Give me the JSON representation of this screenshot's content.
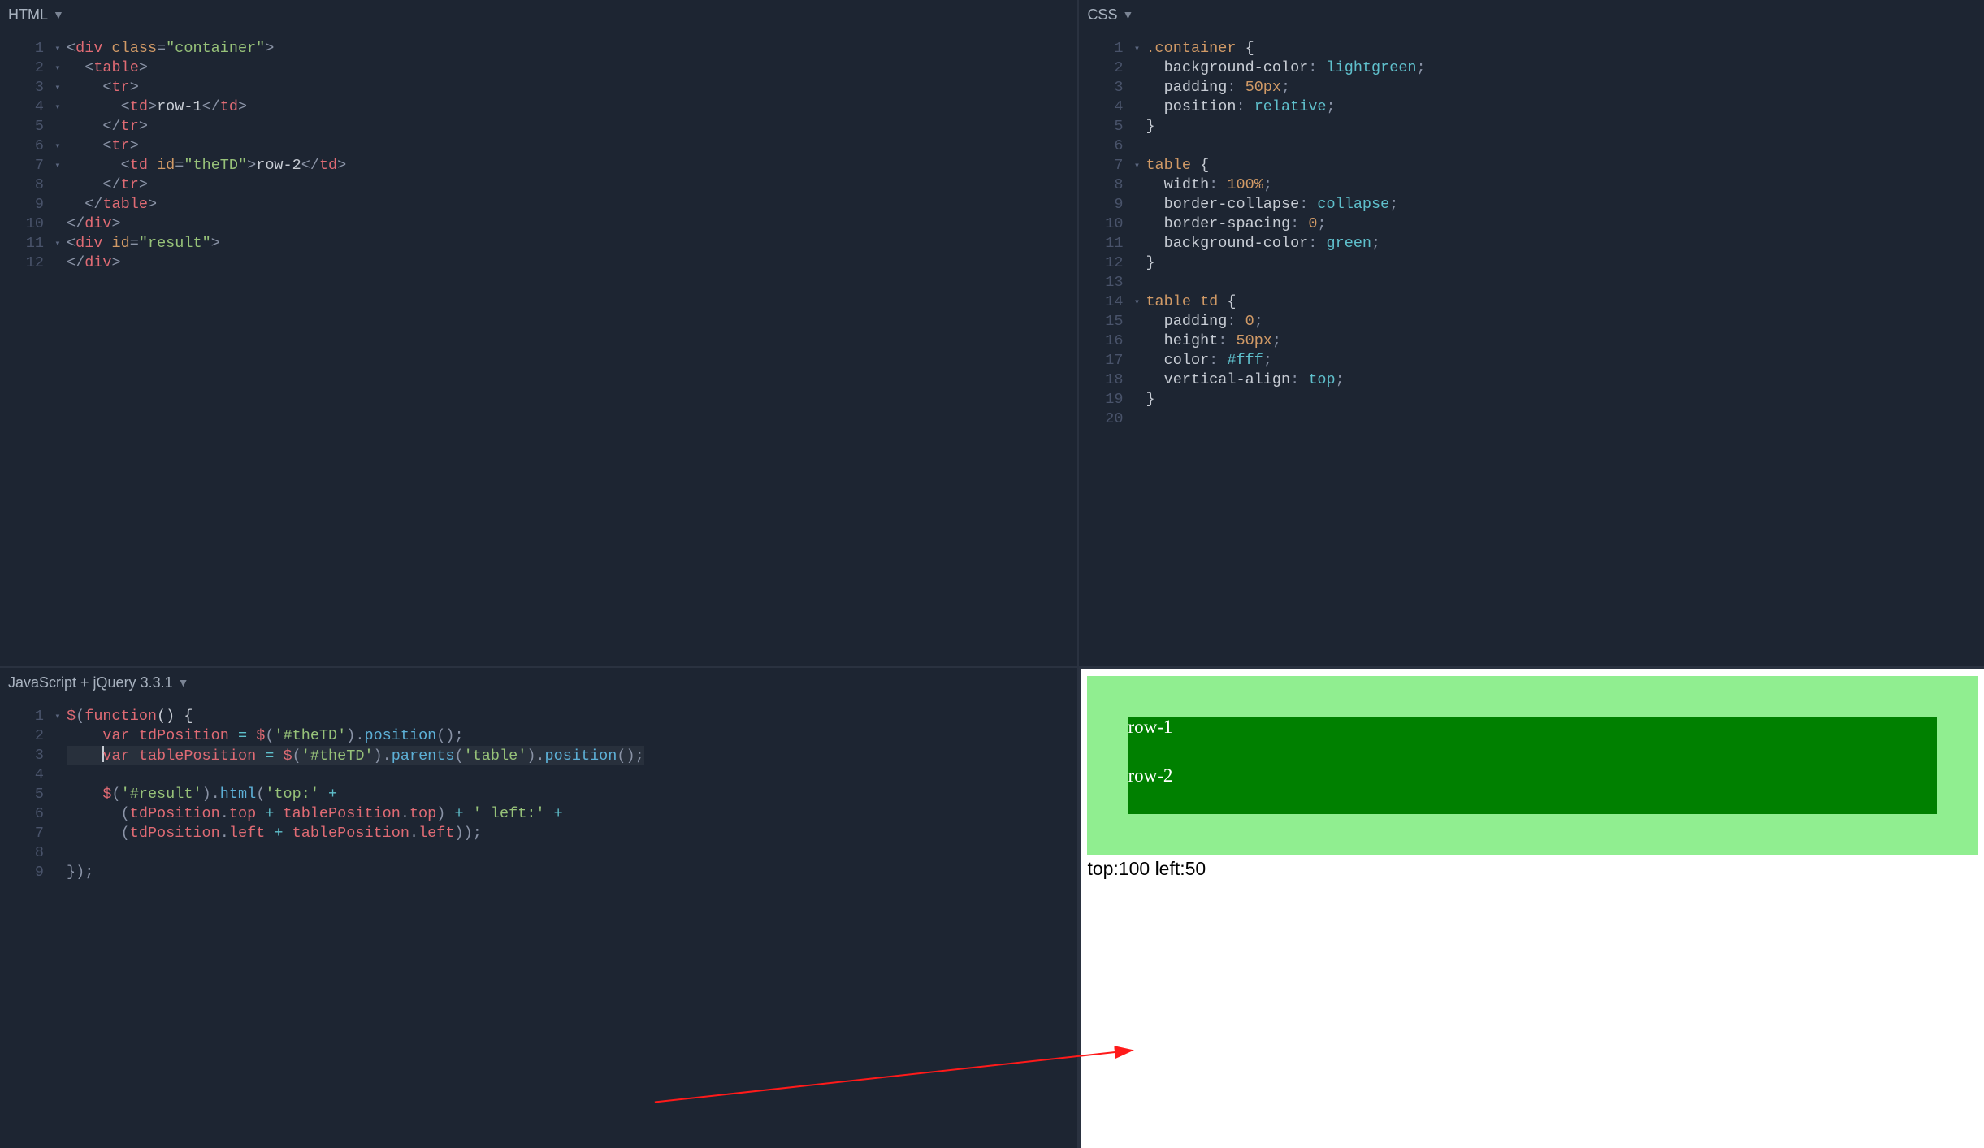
{
  "panes": {
    "html": {
      "title": "HTML",
      "lines": {
        "count": 12,
        "fold": [
          "▾",
          "▾",
          "▾",
          "▾",
          "",
          "▾",
          "▾",
          "",
          "",
          "",
          "▾",
          ""
        ],
        "tokens": [
          [
            [
              "<",
              "c-punct"
            ],
            [
              "div",
              "c-tag"
            ],
            [
              " ",
              "c-text"
            ],
            [
              "class",
              "c-attr"
            ],
            [
              "=",
              "c-punct"
            ],
            [
              "\"container\"",
              "c-string"
            ],
            [
              ">",
              "c-punct"
            ]
          ],
          [
            [
              "  ",
              "c-text"
            ],
            [
              "<",
              "c-punct"
            ],
            [
              "table",
              "c-tag"
            ],
            [
              ">",
              "c-punct"
            ]
          ],
          [
            [
              "    ",
              "c-text"
            ],
            [
              "<",
              "c-punct"
            ],
            [
              "tr",
              "c-tag"
            ],
            [
              ">",
              "c-punct"
            ]
          ],
          [
            [
              "      ",
              "c-text"
            ],
            [
              "<",
              "c-punct"
            ],
            [
              "td",
              "c-tag"
            ],
            [
              ">",
              "c-punct"
            ],
            [
              "row-1",
              "c-text"
            ],
            [
              "</",
              "c-punct"
            ],
            [
              "td",
              "c-tag"
            ],
            [
              ">",
              "c-punct"
            ]
          ],
          [
            [
              "    ",
              "c-text"
            ],
            [
              "</",
              "c-punct"
            ],
            [
              "tr",
              "c-tag"
            ],
            [
              ">",
              "c-punct"
            ]
          ],
          [
            [
              "    ",
              "c-text"
            ],
            [
              "<",
              "c-punct"
            ],
            [
              "tr",
              "c-tag"
            ],
            [
              ">",
              "c-punct"
            ]
          ],
          [
            [
              "      ",
              "c-text"
            ],
            [
              "<",
              "c-punct"
            ],
            [
              "td",
              "c-tag"
            ],
            [
              " ",
              "c-text"
            ],
            [
              "id",
              "c-attr"
            ],
            [
              "=",
              "c-punct"
            ],
            [
              "\"theTD\"",
              "c-string"
            ],
            [
              ">",
              "c-punct"
            ],
            [
              "row-2",
              "c-text"
            ],
            [
              "</",
              "c-punct"
            ],
            [
              "td",
              "c-tag"
            ],
            [
              ">",
              "c-punct"
            ]
          ],
          [
            [
              "    ",
              "c-text"
            ],
            [
              "</",
              "c-punct"
            ],
            [
              "tr",
              "c-tag"
            ],
            [
              ">",
              "c-punct"
            ]
          ],
          [
            [
              "  ",
              "c-text"
            ],
            [
              "</",
              "c-punct"
            ],
            [
              "table",
              "c-tag"
            ],
            [
              ">",
              "c-punct"
            ]
          ],
          [
            [
              "</",
              "c-punct"
            ],
            [
              "div",
              "c-tag"
            ],
            [
              ">",
              "c-punct"
            ]
          ],
          [
            [
              "<",
              "c-punct"
            ],
            [
              "div",
              "c-tag"
            ],
            [
              " ",
              "c-text"
            ],
            [
              "id",
              "c-attr"
            ],
            [
              "=",
              "c-punct"
            ],
            [
              "\"result\"",
              "c-string"
            ],
            [
              ">",
              "c-punct"
            ]
          ],
          [
            [
              "</",
              "c-punct"
            ],
            [
              "div",
              "c-tag"
            ],
            [
              ">",
              "c-punct"
            ]
          ]
        ]
      }
    },
    "css": {
      "title": "CSS",
      "lines": {
        "count": 20,
        "fold": [
          "▾",
          "",
          "",
          "",
          "",
          "",
          "▾",
          "",
          "",
          "",
          "",
          "",
          "",
          "▾",
          "",
          "",
          "",
          "",
          "",
          ""
        ],
        "tokens": [
          [
            [
              ".container",
              "c-sel"
            ],
            [
              " ",
              "c-text"
            ],
            [
              "{",
              "c-brace"
            ]
          ],
          [
            [
              "  ",
              "c-text"
            ],
            [
              "background-color",
              "c-prop"
            ],
            [
              ":",
              "c-punct"
            ],
            [
              " ",
              "c-text"
            ],
            [
              "lightgreen",
              "c-value"
            ],
            [
              ";",
              "c-punct"
            ]
          ],
          [
            [
              "  ",
              "c-text"
            ],
            [
              "padding",
              "c-prop"
            ],
            [
              ":",
              "c-punct"
            ],
            [
              " ",
              "c-text"
            ],
            [
              "50px",
              "c-num"
            ],
            [
              ";",
              "c-punct"
            ]
          ],
          [
            [
              "  ",
              "c-text"
            ],
            [
              "position",
              "c-prop"
            ],
            [
              ":",
              "c-punct"
            ],
            [
              " ",
              "c-text"
            ],
            [
              "relative",
              "c-value"
            ],
            [
              ";",
              "c-punct"
            ]
          ],
          [
            [
              "}",
              "c-brace"
            ]
          ],
          [
            [
              "",
              "c-text"
            ]
          ],
          [
            [
              "table",
              "c-sel"
            ],
            [
              " ",
              "c-text"
            ],
            [
              "{",
              "c-brace"
            ]
          ],
          [
            [
              "  ",
              "c-text"
            ],
            [
              "width",
              "c-prop"
            ],
            [
              ":",
              "c-punct"
            ],
            [
              " ",
              "c-text"
            ],
            [
              "100%",
              "c-num"
            ],
            [
              ";",
              "c-punct"
            ]
          ],
          [
            [
              "  ",
              "c-text"
            ],
            [
              "border-collapse",
              "c-prop"
            ],
            [
              ":",
              "c-punct"
            ],
            [
              " ",
              "c-text"
            ],
            [
              "collapse",
              "c-value"
            ],
            [
              ";",
              "c-punct"
            ]
          ],
          [
            [
              "  ",
              "c-text"
            ],
            [
              "border-spacing",
              "c-prop"
            ],
            [
              ":",
              "c-punct"
            ],
            [
              " ",
              "c-text"
            ],
            [
              "0",
              "c-num"
            ],
            [
              ";",
              "c-punct"
            ]
          ],
          [
            [
              "  ",
              "c-text"
            ],
            [
              "background-color",
              "c-prop"
            ],
            [
              ":",
              "c-punct"
            ],
            [
              " ",
              "c-text"
            ],
            [
              "green",
              "c-value"
            ],
            [
              ";",
              "c-punct"
            ]
          ],
          [
            [
              "}",
              "c-brace"
            ]
          ],
          [
            [
              "",
              "c-text"
            ]
          ],
          [
            [
              "table",
              "c-sel"
            ],
            [
              " ",
              "c-text"
            ],
            [
              "td",
              "c-sel"
            ],
            [
              " ",
              "c-text"
            ],
            [
              "{",
              "c-brace"
            ]
          ],
          [
            [
              "  ",
              "c-text"
            ],
            [
              "padding",
              "c-prop"
            ],
            [
              ":",
              "c-punct"
            ],
            [
              " ",
              "c-text"
            ],
            [
              "0",
              "c-num"
            ],
            [
              ";",
              "c-punct"
            ]
          ],
          [
            [
              "  ",
              "c-text"
            ],
            [
              "height",
              "c-prop"
            ],
            [
              ":",
              "c-punct"
            ],
            [
              " ",
              "c-text"
            ],
            [
              "50px",
              "c-num"
            ],
            [
              ";",
              "c-punct"
            ]
          ],
          [
            [
              "  ",
              "c-text"
            ],
            [
              "color",
              "c-prop"
            ],
            [
              ":",
              "c-punct"
            ],
            [
              " ",
              "c-text"
            ],
            [
              "#fff",
              "c-hex"
            ],
            [
              ";",
              "c-punct"
            ]
          ],
          [
            [
              "  ",
              "c-text"
            ],
            [
              "vertical-align",
              "c-prop"
            ],
            [
              ":",
              "c-punct"
            ],
            [
              " ",
              "c-text"
            ],
            [
              "top",
              "c-value"
            ],
            [
              ";",
              "c-punct"
            ]
          ],
          [
            [
              "}",
              "c-brace"
            ]
          ],
          [
            [
              "",
              "c-text"
            ]
          ]
        ]
      }
    },
    "js": {
      "title": "JavaScript + jQuery 3.3.1",
      "active_line_index": 2,
      "lines": {
        "count": 9,
        "fold": [
          "▾",
          "",
          "",
          "",
          "",
          "",
          "",
          "",
          ""
        ],
        "tokens": [
          [
            [
              "$",
              "c-var2"
            ],
            [
              "(",
              "c-punct"
            ],
            [
              "function",
              "c-key"
            ],
            [
              "() {",
              "c-brace"
            ]
          ],
          [
            [
              "    ",
              "c-text"
            ],
            [
              "var",
              "c-key"
            ],
            [
              " ",
              "c-text"
            ],
            [
              "tdPosition",
              "c-var2"
            ],
            [
              " ",
              "c-text"
            ],
            [
              "=",
              "c-op"
            ],
            [
              " ",
              "c-text"
            ],
            [
              "$",
              "c-var2"
            ],
            [
              "(",
              "c-punct"
            ],
            [
              "'#theTD'",
              "c-string"
            ],
            [
              ")",
              "c-punct"
            ],
            [
              ".",
              "c-punct"
            ],
            [
              "position",
              "c-fn"
            ],
            [
              "();",
              "c-punct"
            ]
          ],
          [
            [
              "    ",
              "c-text"
            ],
            [
              "var",
              "c-key"
            ],
            [
              " ",
              "c-text"
            ],
            [
              "tablePosition",
              "c-var2"
            ],
            [
              " ",
              "c-text"
            ],
            [
              "=",
              "c-op"
            ],
            [
              " ",
              "c-text"
            ],
            [
              "$",
              "c-var2"
            ],
            [
              "(",
              "c-punct"
            ],
            [
              "'#theTD'",
              "c-string"
            ],
            [
              ")",
              "c-punct"
            ],
            [
              ".",
              "c-punct"
            ],
            [
              "parents",
              "c-fn"
            ],
            [
              "(",
              "c-punct"
            ],
            [
              "'table'",
              "c-string"
            ],
            [
              ")",
              "c-punct"
            ],
            [
              ".",
              "c-punct"
            ],
            [
              "position",
              "c-fn"
            ],
            [
              "();",
              "c-punct"
            ]
          ],
          [
            [
              "",
              "c-text"
            ]
          ],
          [
            [
              "    ",
              "c-text"
            ],
            [
              "$",
              "c-var2"
            ],
            [
              "(",
              "c-punct"
            ],
            [
              "'#result'",
              "c-string"
            ],
            [
              ")",
              "c-punct"
            ],
            [
              ".",
              "c-punct"
            ],
            [
              "html",
              "c-fn"
            ],
            [
              "(",
              "c-punct"
            ],
            [
              "'top:'",
              "c-string"
            ],
            [
              " ",
              "c-text"
            ],
            [
              "+",
              "c-op"
            ]
          ],
          [
            [
              "      ",
              "c-text"
            ],
            [
              "(",
              "c-punct"
            ],
            [
              "tdPosition",
              "c-var2"
            ],
            [
              ".",
              "c-punct"
            ],
            [
              "top",
              "c-var2"
            ],
            [
              " ",
              "c-text"
            ],
            [
              "+",
              "c-op"
            ],
            [
              " ",
              "c-text"
            ],
            [
              "tablePosition",
              "c-var2"
            ],
            [
              ".",
              "c-punct"
            ],
            [
              "top",
              "c-var2"
            ],
            [
              ")",
              "c-punct"
            ],
            [
              " ",
              "c-text"
            ],
            [
              "+",
              "c-op"
            ],
            [
              " ",
              "c-text"
            ],
            [
              "' left:'",
              "c-string"
            ],
            [
              " ",
              "c-text"
            ],
            [
              "+",
              "c-op"
            ]
          ],
          [
            [
              "      ",
              "c-text"
            ],
            [
              "(",
              "c-punct"
            ],
            [
              "tdPosition",
              "c-var2"
            ],
            [
              ".",
              "c-punct"
            ],
            [
              "left",
              "c-var2"
            ],
            [
              " ",
              "c-text"
            ],
            [
              "+",
              "c-op"
            ],
            [
              " ",
              "c-text"
            ],
            [
              "tablePosition",
              "c-var2"
            ],
            [
              ".",
              "c-punct"
            ],
            [
              "left",
              "c-var2"
            ],
            [
              "));",
              "c-punct"
            ]
          ],
          [
            [
              "",
              "c-text"
            ]
          ],
          [
            [
              "});",
              "c-punct"
            ]
          ]
        ]
      }
    }
  },
  "output": {
    "row1": "row-1",
    "row2": "row-2",
    "result": "top:100 left:50"
  }
}
